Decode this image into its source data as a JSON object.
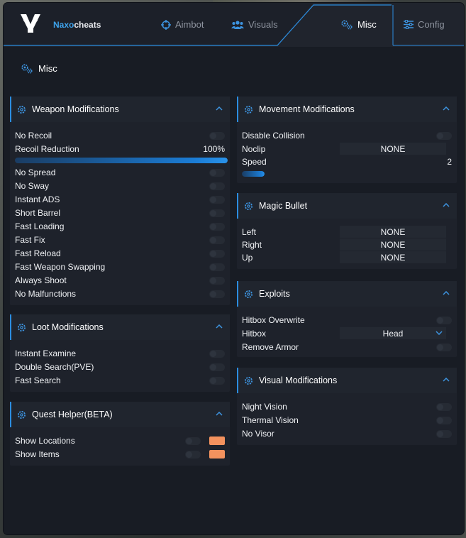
{
  "brand": {
    "part1": "Naxo",
    "part2": "cheats"
  },
  "tabs": [
    {
      "label": "Aimbot",
      "icon": "crosshair-icon"
    },
    {
      "label": "Visuals",
      "icon": "users-icon"
    },
    {
      "label": "Misc",
      "icon": "gears-icon",
      "active": true
    },
    {
      "label": "Config",
      "icon": "sliders-icon"
    }
  ],
  "subheader": {
    "label": "Misc"
  },
  "accent_color": "#2b8de0",
  "swatch_color": "#f4925e",
  "weapon": {
    "title": "Weapon Modifications",
    "no_recoil": "No Recoil",
    "recoil_reduction": "Recoil Reduction",
    "recoil_reduction_value": "100%",
    "recoil_reduction_level": 1.0,
    "items": [
      "No Spread",
      "No Sway",
      "Instant ADS",
      "Short Barrel",
      "Fast Loading",
      "Fast Fix",
      "Fast Reload",
      "Fast Weapon Swapping",
      "Always Shoot",
      "No Malfunctions"
    ]
  },
  "loot": {
    "title": "Loot Modifications",
    "items": [
      "Instant Examine",
      "Double Search(PVE)",
      "Fast Search"
    ]
  },
  "quest": {
    "title": "Quest Helper(BETA)",
    "items": [
      "Show Locations",
      "Show Items"
    ]
  },
  "movement": {
    "title": "Movement Modifications",
    "disable_collision": "Disable Collision",
    "noclip": "Noclip",
    "noclip_key": "NONE",
    "speed": "Speed",
    "speed_value": "2",
    "speed_level": 0.11
  },
  "magic": {
    "title": "Magic Bullet",
    "rows": [
      {
        "label": "Left",
        "key": "NONE"
      },
      {
        "label": "Right",
        "key": "NONE"
      },
      {
        "label": "Up",
        "key": "NONE"
      }
    ]
  },
  "exploits": {
    "title": "Exploits",
    "hitbox_overwrite": "Hitbox Overwrite",
    "hitbox": "Hitbox",
    "hitbox_value": "Head",
    "remove_armor": "Remove Armor"
  },
  "visual_mods": {
    "title": "Visual Modifications",
    "items": [
      "Night Vision",
      "Thermal Vision",
      "No Visor"
    ]
  }
}
